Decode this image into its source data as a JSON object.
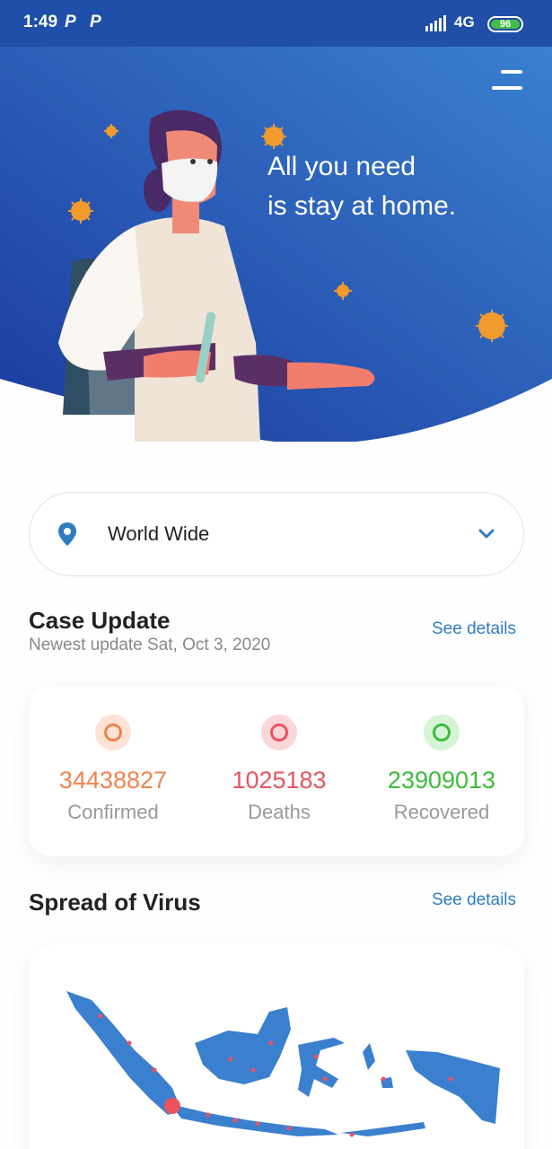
{
  "status_bar": {
    "time": "1:49",
    "app_icons": [
      "P",
      "P"
    ],
    "network": "4G",
    "battery": "96"
  },
  "hero": {
    "title_line1": "All you need",
    "title_line2": "is stay at home."
  },
  "location": {
    "selected": "World Wide"
  },
  "case_update": {
    "title": "Case Update",
    "subtitle": "Newest update Sat, Oct 3, 2020",
    "see_details": "See details",
    "stats": [
      {
        "value": "34438827",
        "label": "Confirmed",
        "color": "#f0844e"
      },
      {
        "value": "1025183",
        "label": "Deaths",
        "color": "#e9545e"
      },
      {
        "value": "23909013",
        "label": "Recovered",
        "color": "#3cbb3c"
      }
    ]
  },
  "spread": {
    "title": "Spread of Virus",
    "see_details": "See details"
  },
  "colors": {
    "primary": "#2f7cc2",
    "hero_dark": "#1b3a9e",
    "hero_light": "#3a80d0",
    "virus": "#f29a2e",
    "map_land": "#3b80cf",
    "map_dot": "#e9545e"
  }
}
